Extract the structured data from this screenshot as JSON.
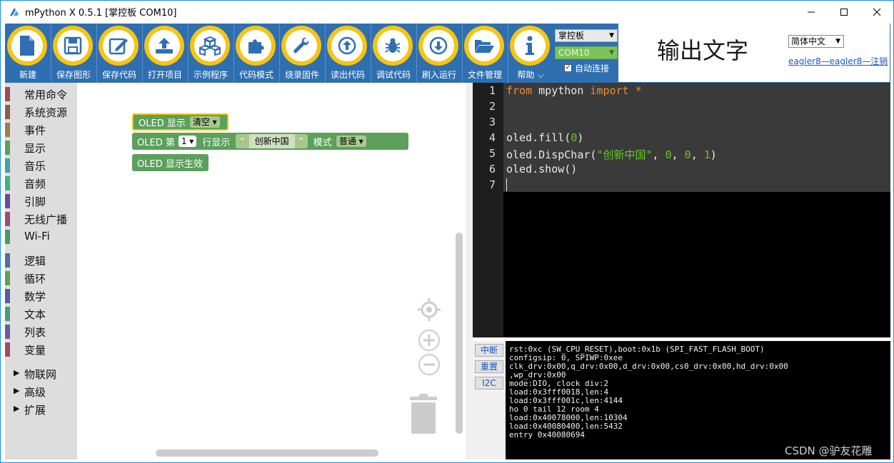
{
  "window": {
    "title": "mPython X 0.5.1 [掌控板 COM10]"
  },
  "toolbar": {
    "items": [
      {
        "label": "新建",
        "icon": "file-icon"
      },
      {
        "label": "保存图形",
        "icon": "save-icon"
      },
      {
        "label": "保存代码",
        "icon": "edit-icon"
      },
      {
        "label": "打开项目",
        "icon": "upload-icon"
      },
      {
        "label": "示例程序",
        "icon": "cubes-icon"
      },
      {
        "label": "代码模式",
        "icon": "puzzle-icon"
      },
      {
        "label": "烧录固件",
        "icon": "wrench-icon"
      },
      {
        "label": "读出代码",
        "icon": "arrow-up-circle-icon"
      },
      {
        "label": "调试代码",
        "icon": "bug-icon"
      },
      {
        "label": "刷入运行",
        "icon": "arrow-down-circle-icon"
      },
      {
        "label": "文件管理",
        "icon": "folder-open-icon"
      },
      {
        "label": "帮助 ⌵",
        "icon": "info-icon"
      }
    ],
    "board_select": "掌控板",
    "port_select": "COM10",
    "auto_connect_label": "自动连接",
    "auto_connect_checked": "✓",
    "output_text": "输出文字",
    "language_select": "简体中文",
    "user_link": "eagler8—eagler8—注销",
    "accent_color": "#f6c414",
    "toolbar_color": "#2f6fb0"
  },
  "sidebar": {
    "categories": [
      {
        "label": "常用命令",
        "color": "#9a4a5a"
      },
      {
        "label": "系统资源",
        "color": "#8e5a4a"
      },
      {
        "label": "事件",
        "color": "#a07c4a"
      },
      {
        "label": "显示",
        "color": "#5ba05b"
      },
      {
        "label": "音乐",
        "color": "#4aa0a0"
      },
      {
        "label": "音频",
        "color": "#3ab08a"
      },
      {
        "label": "引脚",
        "color": "#6a4a9a"
      },
      {
        "label": "无线广播",
        "color": "#a04a7a"
      },
      {
        "label": "Wi-Fi",
        "color": "#4a9a6a"
      },
      {
        "label": "逻辑",
        "color": "#5a6aa0"
      },
      {
        "label": "循环",
        "color": "#5aa05a"
      },
      {
        "label": "数学",
        "color": "#5a5aa0"
      },
      {
        "label": "文本",
        "color": "#4a9a7a"
      },
      {
        "label": "列表",
        "color": "#6a5aa0"
      },
      {
        "label": "变量",
        "color": "#a04a6a"
      }
    ],
    "groups": [
      {
        "label": "物联网",
        "arrow": "▶"
      },
      {
        "label": "高级",
        "arrow": "▶"
      },
      {
        "label": "扩展",
        "arrow": "▶"
      }
    ]
  },
  "blocks": {
    "oled_show_label": "OLED 显示",
    "oled_show_field": "清空 ▾",
    "line_prefix": "OLED 第",
    "line_number": "1 ▾",
    "line_show": "行显示",
    "quote_open": "“",
    "text_value": "创新中国",
    "quote_close": "”",
    "mode_label": "模式",
    "mode_field": "普通 ▾",
    "oled_apply": "OLED 显示生效",
    "block_color": "#5ba05b"
  },
  "editor": {
    "line_numbers": [
      "1",
      "2",
      "3",
      "4",
      "5",
      "6",
      "7"
    ],
    "line1_kw1": "from",
    "line1_mod": " mpython ",
    "line1_kw2": "import *",
    "line4_a": "oled.fill(",
    "line4_num": "0",
    "line4_b": ")",
    "line5_a": "oled.DispChar(",
    "line5_str": "\"创新中国\"",
    "line5_sep1": ", ",
    "line5_n1": "0",
    "line5_sep2": ", ",
    "line5_n2": "0",
    "line5_sep3": ", ",
    "line5_n3": "1",
    "line5_b": ")",
    "line6": "oled.show()"
  },
  "console": {
    "buttons": [
      "中断",
      "重置",
      "I2C"
    ],
    "lines": [
      "rst:0xc (SW_CPU_RESET),boot:0x1b (SPI_FAST_FLASH_BOOT)",
      "configsip: 0, SPIWP:0xee",
      "clk_drv:0x00,q_drv:0x00,d_drv:0x00,cs0_drv:0x00,hd_drv:0x00",
      ",wp_drv:0x00",
      "mode:DIO, clock div:2",
      "load:0x3fff0018,len:4",
      "load:0x3fff001c,len:4144",
      "ho 0 tail 12 room 4",
      "load:0x40078000,len:10304",
      "load:0x40080400,len:5432",
      "entry 0x40080694"
    ]
  },
  "watermark": "CSDN @驴友花雕"
}
